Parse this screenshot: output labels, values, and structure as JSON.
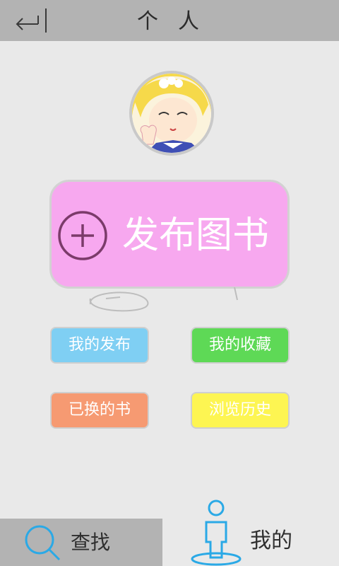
{
  "header": {
    "title": "个人",
    "back_icon": "return-arrow-icon"
  },
  "profile": {
    "avatar_icon": "avatar"
  },
  "publish": {
    "label": "发布图书",
    "icon": "plus-circle-icon",
    "color": "#f7a8ef"
  },
  "options": {
    "my_published": "我的发布",
    "my_favorites": "我的收藏",
    "exchanged_books": "已换的书",
    "browse_history": "浏览历史"
  },
  "nav": {
    "search_label": "查找",
    "mine_label": "我的"
  },
  "colors": {
    "header_bg": "#b3b3b3",
    "background": "#e9e9e9",
    "blue": "#7fcff3",
    "green": "#5ed956",
    "orange": "#f69a72",
    "yellow": "#fdf552",
    "accent_icon": "#2aa9e6"
  }
}
